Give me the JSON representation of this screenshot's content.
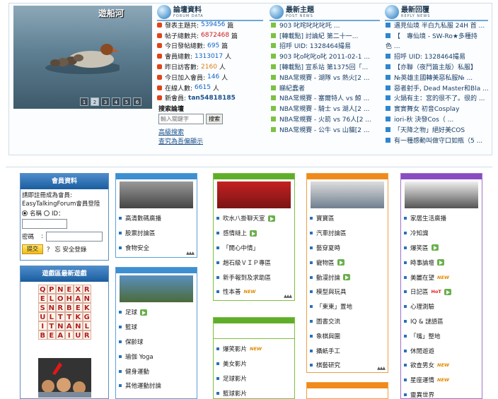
{
  "slideshow": {
    "title": "遊船河",
    "dots": [
      "1",
      "2",
      "3",
      "4",
      "5",
      "6"
    ]
  },
  "columns": {
    "forum_data": {
      "title": "論壇資料",
      "sub": "FORUM DATA"
    },
    "latest_topics": {
      "title": "最新主題",
      "sub": "POST NEWS"
    },
    "latest_replies": {
      "title": "最新回覆",
      "sub": "REPLY NEWS"
    }
  },
  "stats": [
    {
      "label": "發表主題共:",
      "value": "539456",
      "unit": "篇",
      "color": "blue"
    },
    {
      "label": "帖子總數共:",
      "value": "6872468",
      "unit": "篇",
      "color": "red"
    },
    {
      "label": "今日發帖總數:",
      "value": "695",
      "unit": "篇",
      "color": "blue"
    },
    {
      "label": "會員總數:",
      "value": "1313017",
      "unit": "人",
      "color": "blue"
    },
    {
      "label": "昨日訪客數:",
      "value": "2160",
      "unit": "人",
      "color": "orange"
    },
    {
      "label": "今日加入會員:",
      "value": "146",
      "unit": "人",
      "color": "blue"
    },
    {
      "label": "在線人數:",
      "value": "6615",
      "unit": "人",
      "color": "blue"
    },
    {
      "label": "新會員:",
      "value": "tan54818185",
      "unit": "",
      "color": "bold"
    }
  ],
  "search": {
    "title": "搜索論壇",
    "placeholder": "輸入關鍵字",
    "button": "搜索",
    "advanced": "高級搜索",
    "help": "查究為吾偏顯示"
  },
  "latest_topics": [
    "903 叱咤叱叱叱吒 ...",
    "[轉載點] 討論紀 第二十一...",
    "招呼 UID: 1328464撮易",
    "903 叱o叱叱o叱 2011-02-1 ...",
    "[轉載點] 宣系站 第1375回「...",
    "NBA常規賽 - 湖隊 vs 熱火[2 ...",
    "睇紀蠢者",
    "NBA常規賽 - 塞爾特人 vs 鯨 ...",
    "NBA常規賽 - 騎士 vs 湖人[2 ...",
    "NBA常規賽 - 火箭 vs 76人[2 ...",
    "NBA常規賽 - 公牛 vs 山貓[2 ..."
  ],
  "latest_replies": [
    "遇見仙境 半白九私服 24H 首 ...",
    "【　專仙境 - SW-Ro★多種持",
    "色 ...",
    "招呼 UID: 1328464撮易",
    "【亦聯（夜鬥篇主版）私服】",
    "№英雄主國轉美惡私服№ ...",
    "惡者射手, Dead Master和Bla ...",
    "火鍋有主：宮的很不了。很的 ...",
    "實實舞女 初音Cosplay",
    "iori-秋 決發Cos（ ...",
    "「天降之物」絕好美COS",
    "有一種感動叫做守口如瓶（5 ..."
  ],
  "member": {
    "title": "會員資料",
    "prompt": "請即註冊成為會員:",
    "site_login": "EasyTalkingForum會員登陸",
    "opt_name": "名稱",
    "opt_id": "ID：",
    "pw_label": "密碼",
    "login": "提交",
    "safe": "？ 忘 安全登錄"
  },
  "game": {
    "title": "遊戲區最新遊戲",
    "letters": [
      "Q",
      "P",
      "N",
      "E",
      "X",
      "R",
      "E",
      "L",
      "O",
      "H",
      "A",
      "N",
      "S",
      "N",
      "R",
      "B",
      "E",
      "K",
      "U",
      "L",
      "T",
      "T",
      "K",
      "G",
      "I",
      "T",
      "N",
      "A",
      "N",
      "L",
      "B",
      "E",
      "A",
      "I",
      "U",
      "R"
    ]
  },
  "forums": [
    {
      "items": [
        {
          "t": "高清數碼廣播"
        },
        {
          "t": "股票討論區"
        },
        {
          "t": "食物安全"
        }
      ]
    },
    {
      "items": [
        {
          "t": "足球",
          "go": true
        },
        {
          "t": "籃球"
        },
        {
          "t": "保齡球"
        },
        {
          "t": "瑜伽 Yoga"
        },
        {
          "t": "健身運動"
        },
        {
          "t": "其他運動討論"
        }
      ]
    },
    {
      "items": [
        {
          "t": "吹水八掛聊天室",
          "go": true
        },
        {
          "t": "感情縫上",
          "go": true
        },
        {
          "t": "「開心中情」"
        },
        {
          "t": "趙石級ＶＩＰ專區"
        },
        {
          "t": "新手報到及求助區"
        },
        {
          "t": "性本善",
          "new": true
        }
      ]
    },
    {
      "items": [
        {
          "t": "爆笑影片",
          "new": true
        },
        {
          "t": "美女影片"
        },
        {
          "t": "足球影片"
        },
        {
          "t": "籃球影片"
        }
      ]
    },
    {
      "items": [
        {
          "t": "寶寶區"
        },
        {
          "t": "汽車討論區"
        },
        {
          "t": "藝穿夏時"
        },
        {
          "t": "寵物區",
          "go": true
        },
        {
          "t": "動漫討論",
          "go": true
        },
        {
          "t": "模型與玩具"
        },
        {
          "t": "「東東」置地"
        },
        {
          "t": "圖書交流"
        },
        {
          "t": "象棋與圍"
        },
        {
          "t": "攝紙手工"
        },
        {
          "t": "棋藝研究"
        }
      ]
    },
    {
      "items": [
        {
          "t": "家居生活廣播"
        },
        {
          "t": "冷知識"
        },
        {
          "t": "爆笑區",
          "go": true
        },
        {
          "t": "時事論壇",
          "go": true
        },
        {
          "t": "美麗在望",
          "new": true
        },
        {
          "t": "日記區",
          "hot": true,
          "go": true
        },
        {
          "t": "心理測驗"
        },
        {
          "t": "IQ & 謎語區"
        },
        {
          "t": "「嘴」整地"
        },
        {
          "t": "休閒遊遊"
        },
        {
          "t": "欲查男女",
          "new": true
        },
        {
          "t": "星座運情",
          "new": true
        },
        {
          "t": "靈異世界"
        }
      ]
    }
  ],
  "tags": {
    "new": "NEW",
    "hot": "HoT"
  }
}
